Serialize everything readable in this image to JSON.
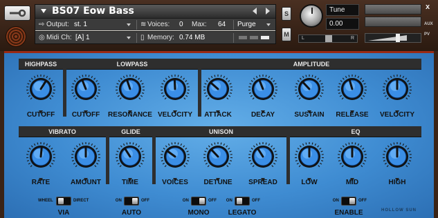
{
  "header": {
    "instrument_name": "BS07 Eow Bass",
    "output_label": "Output:",
    "output_value": "st. 1",
    "voices_label": "Voices:",
    "voices_value": "0",
    "max_label": "Max:",
    "max_value": "64",
    "purge_label": "Purge",
    "midi_label": "Midi Ch:",
    "midi_value": "[A] 1",
    "memory_label": "Memory:",
    "memory_value": "0.74 MB",
    "solo_label": "S",
    "mute_label": "M",
    "tune_label": "Tune",
    "tune_value": "0.00",
    "pan_left": "L",
    "pan_right": "R",
    "aux_label": "AUX",
    "pv_label": "PV",
    "close_label": "x"
  },
  "sections": [
    {
      "title": "HIGHPASS"
    },
    {
      "title": "LOWPASS"
    },
    {
      "title": "AMPLITUDE"
    },
    {
      "title": "VIBRATO"
    },
    {
      "title": "GLIDE"
    },
    {
      "title": "UNISON"
    },
    {
      "title": "EQ"
    }
  ],
  "knobs_row1": [
    {
      "label": "CUTOFF",
      "value": 0.62
    },
    {
      "label": "CUTOFF",
      "value": 0.42
    },
    {
      "label": "RESONANCE",
      "value": 0.43
    },
    {
      "label": "VELOCITY",
      "value": 0.49
    },
    {
      "label": "ATTACK",
      "value": 0.32
    },
    {
      "label": "DECAY",
      "value": 0.42
    },
    {
      "label": "SUSTAIN",
      "value": 0.34
    },
    {
      "label": "RELEASE",
      "value": 0.44
    },
    {
      "label": "VELOCITY",
      "value": 0.5
    }
  ],
  "knobs_row2": [
    {
      "label": "RATE",
      "value": 0.52
    },
    {
      "label": "AMOUNT",
      "value": 0.5
    },
    {
      "label": "TIME",
      "value": 0.38
    },
    {
      "label": "VOICES",
      "value": 0.3
    },
    {
      "label": "DETUNE",
      "value": 0.34
    },
    {
      "label": "SPREAD",
      "value": 0.38
    },
    {
      "label": "LOW",
      "value": 0.5
    },
    {
      "label": "MID",
      "value": 0.5
    },
    {
      "label": "HIGH",
      "value": 0.5
    }
  ],
  "toggles": [
    {
      "name": "VIA",
      "left_label": "WHEEL",
      "right_label": "DIRECT",
      "state": "left"
    },
    {
      "name": "AUTO",
      "left_label": "ON",
      "right_label": "OFF",
      "state": "right"
    },
    {
      "name": "MONO",
      "left_label": "ON",
      "right_label": "OFF",
      "state": "right"
    },
    {
      "name": "LEGATO",
      "left_label": "ON",
      "right_label": "OFF",
      "state": "left"
    },
    {
      "name": "ENABLE",
      "left_label": "ON",
      "right_label": "OFF",
      "state": "right"
    }
  ],
  "brand": "HOLLOW SUN",
  "colors": {
    "knob": "#3a8ee6",
    "panel": "#4f9fe0",
    "header_bar": "#2e2e2e",
    "accent_red": "#9a2a14"
  }
}
